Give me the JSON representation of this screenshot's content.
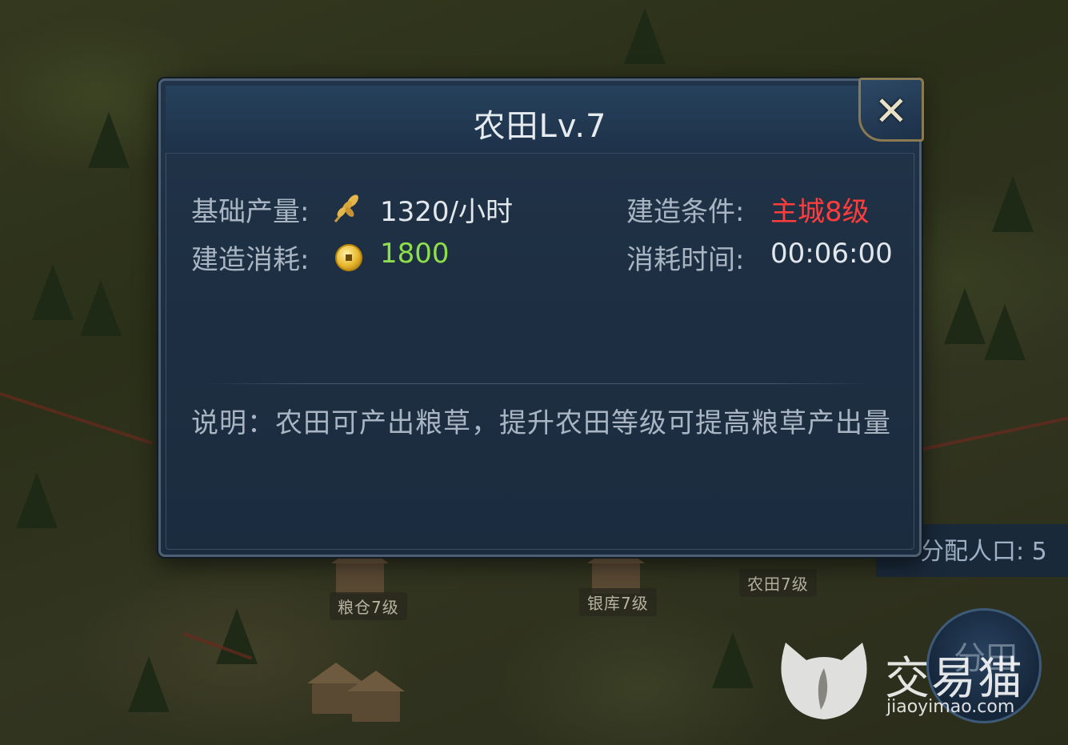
{
  "map": {
    "labels": [
      "粮仓7级",
      "银库7级",
      "农田7级"
    ],
    "population_label": "分配人口: 5",
    "round_button_label": "分田"
  },
  "dialog": {
    "title": "农田Lv.7",
    "close_icon": "close-icon",
    "base_output": {
      "label": "基础产量:",
      "icon": "wheat-icon",
      "value": "1320/小时"
    },
    "build_cost": {
      "label": "建造消耗:",
      "icon": "coin-icon",
      "value": "1800",
      "color": "#8ee04a"
    },
    "build_condition": {
      "label": "建造条件:",
      "value": "主城8级",
      "color": "#ff3d3d"
    },
    "time_cost": {
      "label": "消耗时间:",
      "value": "00:06:00"
    },
    "description": "说明：农田可产出粮草，提升农田等级可提高粮草产出量"
  },
  "watermark": {
    "brand": "交易猫",
    "url": "jiaoyimao.com"
  }
}
